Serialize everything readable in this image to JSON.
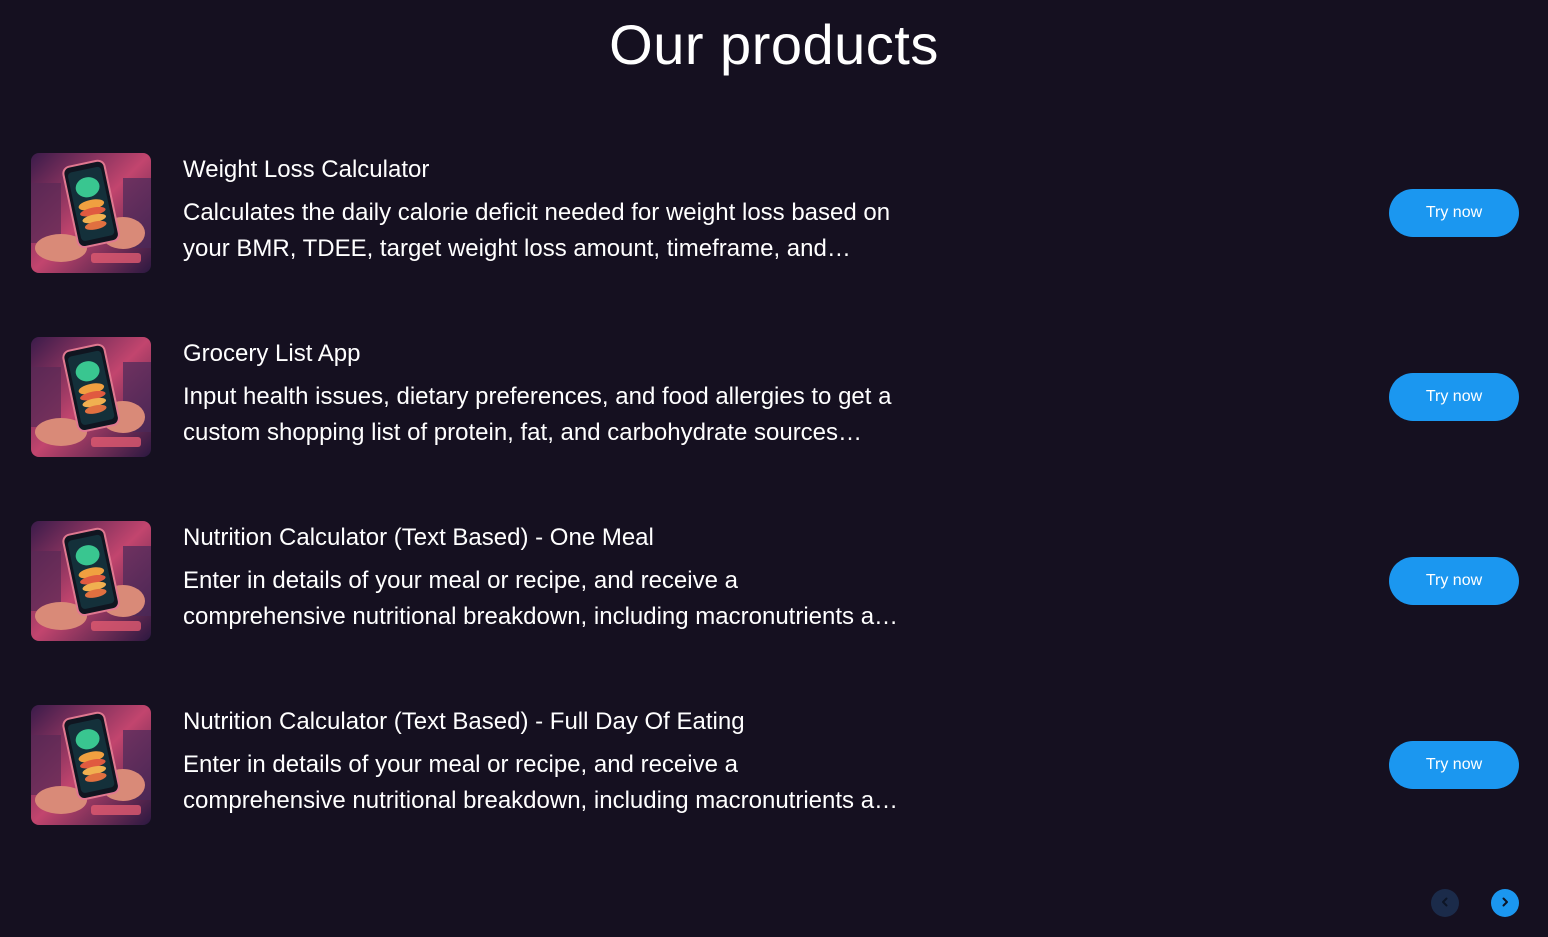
{
  "page": {
    "title": "Our products"
  },
  "products": [
    {
      "name": "Weight Loss Calculator",
      "description": "Calculates the daily calorie deficit needed for weight loss based on your BMR, TDEE, target weight loss amount, timeframe, and activity level.",
      "button_label": "Try now"
    },
    {
      "name": "Grocery List App",
      "description": "Input health issues, dietary preferences, and food allergies to get a custom shopping list of protein, fat, and carbohydrate sources tailored to you.",
      "button_label": "Try now"
    },
    {
      "name": "Nutrition Calculator (Text Based) - One Meal",
      "description": "Enter in details of your meal or recipe, and receive a comprehensive nutritional breakdown, including macronutrients and micronutrients.",
      "button_label": "Try now"
    },
    {
      "name": "Nutrition Calculator (Text Based) - Full Day Of Eating",
      "description": "Enter in details of your meal or recipe, and receive a comprehensive nutritional breakdown, including macronutrients and micronutrients.",
      "button_label": "Try now"
    }
  ],
  "icons": {
    "product_thumbnail": "phone-with-food-illustration",
    "prev": "chevron-left-icon",
    "next": "chevron-right-icon"
  },
  "colors": {
    "background": "#151020",
    "accent": "#1b97f0",
    "pager_inactive": "#1b2b4a",
    "text": "#ffffff"
  }
}
